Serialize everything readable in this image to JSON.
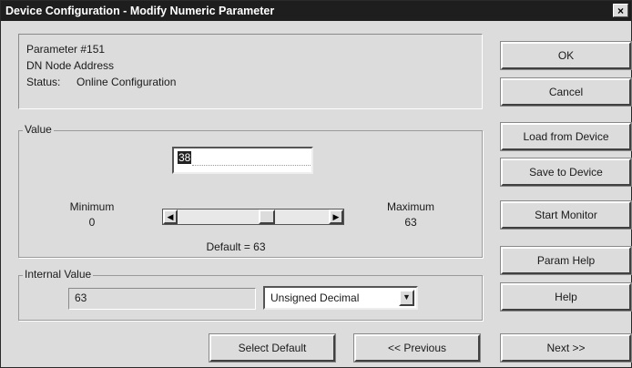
{
  "window": {
    "title": "Device Configuration - Modify Numeric Parameter",
    "close_glyph": "×"
  },
  "info": {
    "parameter": "Parameter #151",
    "name": "DN Node Address",
    "status_label": "Status:",
    "status_value": "Online Configuration"
  },
  "value_group": {
    "label": "Value",
    "input_value": "38",
    "minimum_label": "Minimum",
    "minimum_value": "0",
    "maximum_label": "Maximum",
    "maximum_value": "63",
    "default_text": "Default = 63",
    "slider_left_glyph": "◀",
    "slider_right_glyph": "▶",
    "slider_position": 0.6
  },
  "internal_group": {
    "label": "Internal Value",
    "value": "63",
    "format_selected": "Unsigned Decimal",
    "dropdown_glyph": "▼"
  },
  "buttons": {
    "ok": "OK",
    "cancel": "Cancel",
    "load": "Load from Device",
    "save": "Save to Device",
    "monitor": "Start Monitor",
    "param_help": "Param Help",
    "help": "Help",
    "select_default": "Select Default",
    "previous": "<< Previous",
    "next": "Next >>"
  }
}
